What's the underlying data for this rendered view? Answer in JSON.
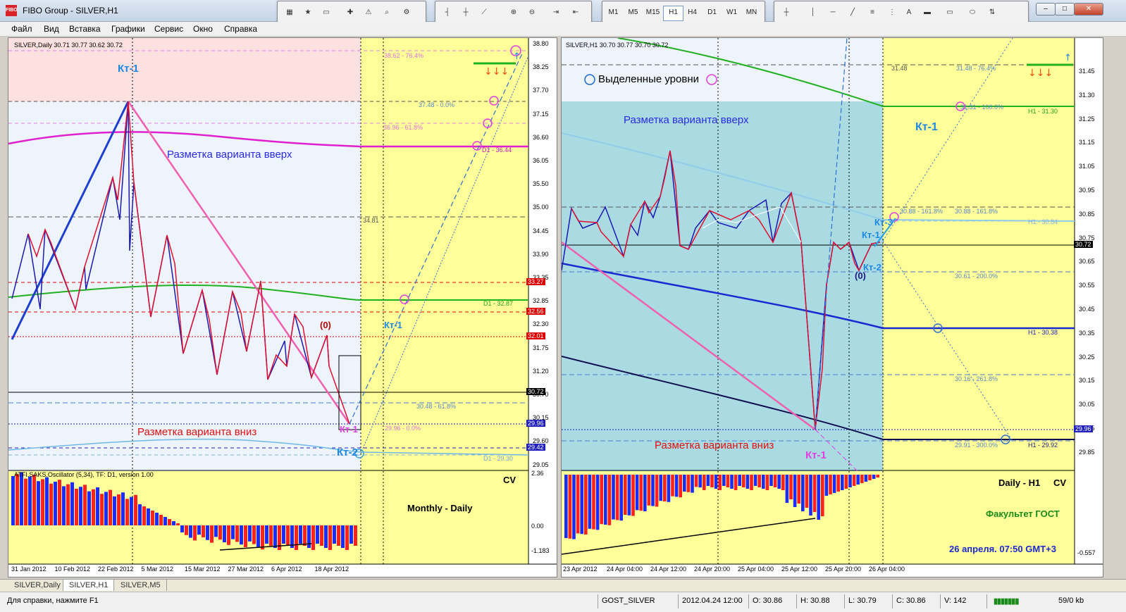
{
  "window": {
    "title": "FIBO Group - SILVER,H1",
    "app_icon": "FIBO"
  },
  "toolbar": {
    "timeframes": [
      "M1",
      "M5",
      "M15",
      "H1",
      "H4",
      "D1",
      "W1",
      "MN"
    ],
    "active_timeframe": "H1",
    "text_tool": "A"
  },
  "menu": [
    "Файл",
    "Вид",
    "Вставка",
    "Графики",
    "Сервис",
    "Окно",
    "Справка"
  ],
  "left_chart": {
    "header": "SILVER,Daily  30.71 30.77 30.62 30.72",
    "indicator_header": "ATFI.SAKS.Oscillator (5,34), TF: D1, version 1.00",
    "price_labels": [
      "38.80",
      "38.25",
      "37.70",
      "37.15",
      "36.60",
      "36.05",
      "35.50",
      "35.00",
      "34.45",
      "33.90",
      "33.35",
      "32.85",
      "32.30",
      "31.75",
      "31.20",
      "30.70",
      "30.15",
      "29.60",
      "29.05"
    ],
    "osc_labels": [
      "2.36",
      "0.00",
      "-1.183"
    ],
    "highlight_prices": [
      {
        "value": "33.27",
        "color": "#e00000"
      },
      {
        "value": "32.56",
        "color": "#e00000"
      },
      {
        "value": "32.01",
        "color": "#e00000"
      },
      {
        "value": "30.72",
        "color": "#000000"
      },
      {
        "value": "29.96",
        "color": "#2020c0"
      },
      {
        "value": "29.42",
        "color": "#2020c0"
      }
    ],
    "date_labels": [
      "31 Jan 2012",
      "10 Feb 2012",
      "22 Feb 2012",
      "5 Mar 2012",
      "15 Mar 2012",
      "27 Mar 2012",
      "6 Apr 2012",
      "18 Apr 2012"
    ],
    "annotations": {
      "kt1_top": "Кт-1",
      "up_variant": "Разметка варианта вверх",
      "down_variant": "Разметка варианта вниз",
      "zero": "(0)",
      "kt1_mid": "Кт-1",
      "kt1_bottom": "Кт-1",
      "kt2": "Кт-2",
      "monthly": "Monthly - Daily",
      "cv": "CV"
    },
    "fib_levels": [
      "38.62 - 76.4%",
      "37.48 - 0.0%",
      "36.96 - 61.8%",
      "D1 - 36.44",
      "34.81",
      "D1 - 32.87",
      "30.48 - 61.8%",
      "29.96 - 0.0%",
      "D1 - 29.30"
    ]
  },
  "right_chart": {
    "header": "SILVER,H1  30.70 30.77 30.70 30.72",
    "price_labels": [
      "31.45",
      "31.30",
      "31.25",
      "31.15",
      "31.05",
      "30.95",
      "30.85",
      "30.75",
      "30.65",
      "30.55",
      "30.45",
      "30.35",
      "30.25",
      "30.15",
      "30.05",
      "29.95",
      "29.85"
    ],
    "osc_labels": [
      "-0.557"
    ],
    "highlight_prices": [
      {
        "value": "30.72",
        "color": "#000000"
      },
      {
        "value": "29.96",
        "color": "#2020c0"
      }
    ],
    "date_labels": [
      "23 Apr 2012",
      "24 Apr 04:00",
      "24 Apr 12:00",
      "24 Apr 20:00",
      "25 Apr 04:00",
      "25 Apr 12:00",
      "25 Apr 20:00",
      "26 Apr 04:00"
    ],
    "annotations": {
      "legend": "Выделенные уровни",
      "up_variant": "Разметка варианта вверх",
      "down_variant": "Разметка варианта вниз",
      "kt1_right": "Кт-1",
      "kt1_bottom": "Кт-1",
      "kt1_small": "Кт-1",
      "kt2": "Кт-2",
      "kt3": "Кт-3",
      "zero": "(0)",
      "daily_h1": "Daily - H1",
      "cv": "CV",
      "faculty": "Факультет ГОСТ",
      "datetime": "26 апреля. 07:50 GMT+3"
    },
    "fib_levels": [
      "31.48",
      "31.48 - 76.4%",
      "31.31 - 100.0%",
      "H1 - 31.30",
      "30.88 - 161.8%",
      "30.88 - 161.8%",
      "H1 - 30.84",
      "30.61 - 200.0%",
      "H1 - 30.38",
      "30.16 - 261.8%",
      "29.91 - 300.0%",
      "H1 - 29.92"
    ]
  },
  "tabs": [
    "SILVER,Daily",
    "SILVER,H1",
    "SILVER,M5"
  ],
  "active_tab": "SILVER,H1",
  "status": {
    "help": "Для справки, нажмите F1",
    "profile": "GOST_SILVER",
    "datetime": "2012.04.24 12:00",
    "open": "O: 30.86",
    "high": "H: 30.88",
    "low": "L: 30.79",
    "close": "C: 30.86",
    "volume": "V: 142",
    "traffic": "59/0 kb"
  },
  "colors": {
    "zone_red": "#fde0e0",
    "zone_yellow": "#ffff99",
    "zone_blue_light": "#eef4fb",
    "zone_teal": "#aadbe3",
    "osc_red": "#ff2020",
    "osc_blue": "#1a2cff",
    "kt_blue": "#1e88e5",
    "kt_magenta": "#e040e0"
  }
}
